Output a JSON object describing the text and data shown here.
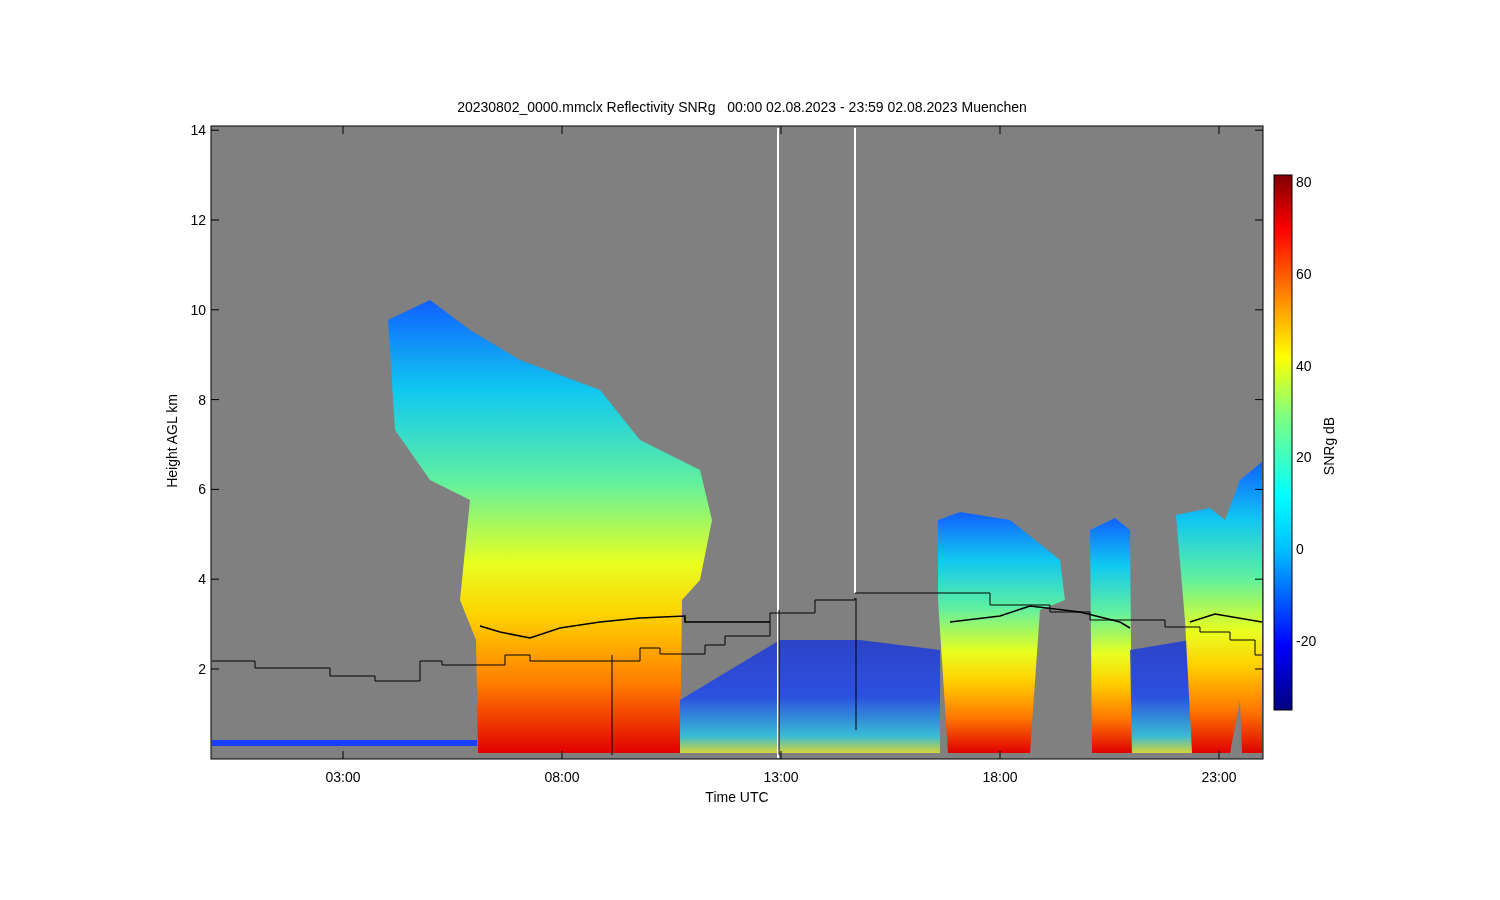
{
  "plot": {
    "title": "20230802_0000.mmclx Reflectivity SNRg   00:00 02.08.2023 - 23:59 02.08.2023 Muenchen",
    "ylabel": "Height AGL km",
    "yticks": [
      "14",
      "12",
      "10",
      "8",
      "6",
      "4",
      "2"
    ],
    "xlabel": "Time UTC",
    "xticks": [
      "03:00",
      "08:00",
      "13:00",
      "18:00",
      "23:00"
    ]
  },
  "colorbar": {
    "label": "SNRg dB",
    "ticks": [
      "80",
      "60",
      "40",
      "20",
      "0",
      "-20"
    ]
  }
}
